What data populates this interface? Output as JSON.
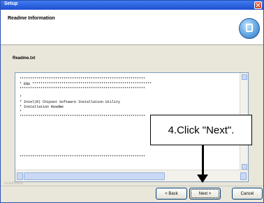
{
  "window": {
    "title": "Setup"
  },
  "header": {
    "title": "Readme Information"
  },
  "content": {
    "sub_label": "Readme.txt",
    "lines": [
      "************************************************************",
      "* ENU *********************************************************",
      "************************************************************",
      "*",
      "* Intel(R) Chipset Software Installation Utility",
      "* Installation Readme",
      "*",
      "************************************************************",
      "************************************************************"
    ]
  },
  "annotation": {
    "text": "4.Click \"Next\"."
  },
  "footer": {
    "brand": "InstallShield",
    "back_label": "< Back",
    "next_label": "Next >",
    "cancel_label": "Cancel"
  }
}
